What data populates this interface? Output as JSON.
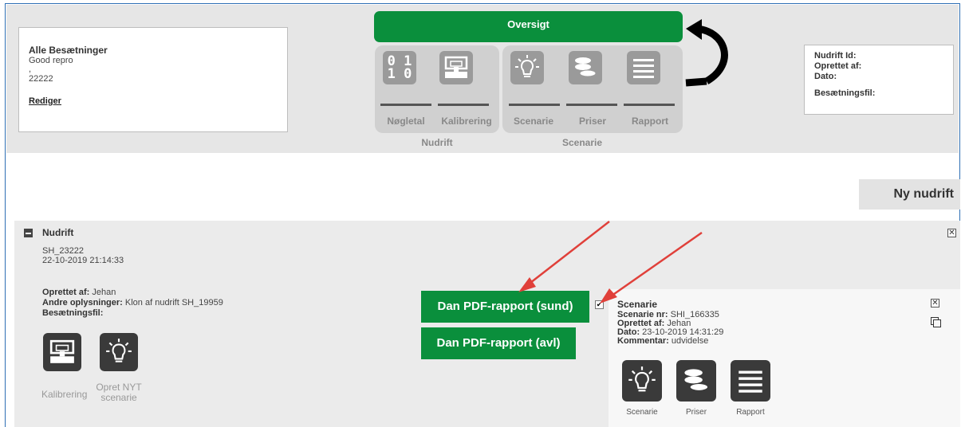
{
  "header": {
    "info_card": {
      "title": "Alle Besætninger",
      "subtitle": "Good repro",
      "comma": ",",
      "number": "22222",
      "edit_link": "Rediger"
    },
    "right_card": {
      "line1": "Nudrift Id:",
      "line2": "Oprettet af:",
      "line3": "Dato:",
      "line4": "Besætningsfil:"
    },
    "oversigt_label": "Oversigt",
    "nav": {
      "nudrift_items": [
        {
          "label": "Nøgletal",
          "icon": "binary-icon"
        },
        {
          "label": "Kalibrering",
          "icon": "calibration-icon"
        }
      ],
      "scenarie_items": [
        {
          "label": "Scenarie",
          "icon": "lightbulb-icon"
        },
        {
          "label": "Priser",
          "icon": "coins-icon"
        },
        {
          "label": "Rapport",
          "icon": "list-icon"
        }
      ],
      "group_nudrift": "Nudrift",
      "group_scenarie": "Scenarie"
    }
  },
  "ny_nudrift_label": "Ny nudrift",
  "nudrift_panel": {
    "title": "Nudrift",
    "id": "SH_23222",
    "datetime": "22-10-2019 21:14:33",
    "oprettet_label": "Oprettet af:",
    "oprettet_value": "Jehan",
    "andre_label": "Andre oplysninger:",
    "andre_value": "Klon af nudrift SH_19959",
    "besaetning_label": "Besætningsfil:",
    "actions": [
      {
        "label": "Kalibrering",
        "icon": "calibration-icon"
      },
      {
        "label": "Opret NYT scenarie",
        "icon": "lightbulb-icon"
      }
    ],
    "pdf_sund": "Dan PDF-rapport (sund)",
    "pdf_avl": "Dan PDF-rapport (avl)"
  },
  "scenario": {
    "title": "Scenarie",
    "nr_label": "Scenarie nr:",
    "nr_value": "SHI_166335",
    "oprettet_label": "Oprettet af:",
    "oprettet_value": "Jehan",
    "dato_label": "Dato:",
    "dato_value": "23-10-2019 14:31:29",
    "kommentar_label": "Kommentar:",
    "kommentar_value": "udvidelse",
    "checked": true,
    "icons": [
      {
        "label": "Scenarie",
        "icon": "lightbulb-icon"
      },
      {
        "label": "Priser",
        "icon": "coins-icon"
      },
      {
        "label": "Rapport",
        "icon": "list-icon"
      }
    ]
  },
  "colors": {
    "green": "#0a8f3c",
    "panel_gray": "#ebebeb",
    "arrow_red": "#e0403a"
  }
}
